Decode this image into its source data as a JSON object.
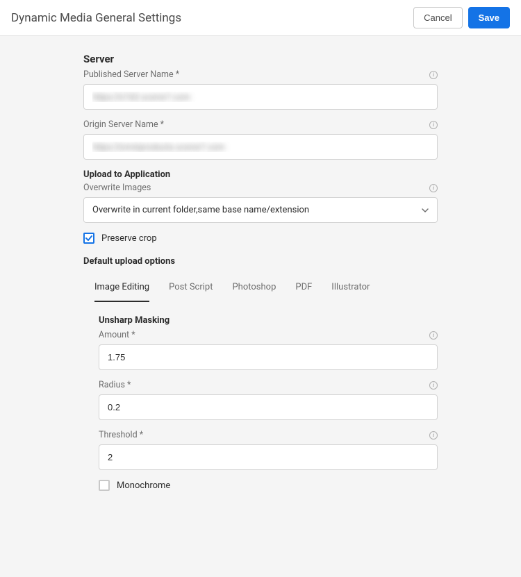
{
  "header": {
    "title": "Dynamic Media General Settings",
    "cancel": "Cancel",
    "save": "Save"
  },
  "server": {
    "heading": "Server",
    "published_label": "Published Server Name *",
    "published_value": "https://s7d2.scene7.com",
    "origin_label": "Origin Server Name *",
    "origin_value": "https://omniproducts.scene7.com"
  },
  "upload": {
    "heading": "Upload to Application",
    "overwrite_label": "Overwrite Images",
    "overwrite_selected": "Overwrite in current folder,same base name/extension",
    "preserve_crop_label": "Preserve crop",
    "preserve_crop_checked": true,
    "default_options_heading": "Default upload options"
  },
  "tabs": {
    "items": [
      {
        "label": "Image Editing",
        "active": true
      },
      {
        "label": "Post Script",
        "active": false
      },
      {
        "label": "Photoshop",
        "active": false
      },
      {
        "label": "PDF",
        "active": false
      },
      {
        "label": "Illustrator",
        "active": false
      }
    ]
  },
  "unsharp": {
    "heading": "Unsharp Masking",
    "amount_label": "Amount *",
    "amount_value": "1.75",
    "radius_label": "Radius *",
    "radius_value": "0.2",
    "threshold_label": "Threshold *",
    "threshold_value": "2",
    "monochrome_label": "Monochrome",
    "monochrome_checked": false
  }
}
